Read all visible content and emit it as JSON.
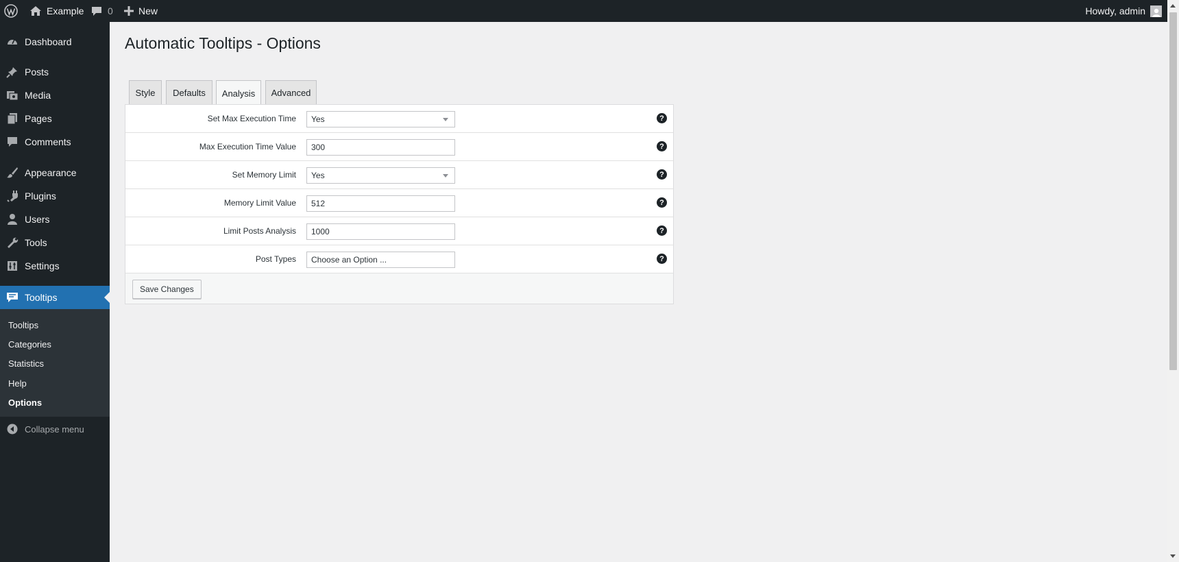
{
  "adminbar": {
    "site_name": "Example",
    "comments_count": "0",
    "new_label": "New",
    "greeting": "Howdy, admin"
  },
  "sidebar": {
    "items": [
      {
        "label": "Dashboard",
        "icon": "dashboard-icon"
      },
      {
        "label": "Posts",
        "icon": "pushpin-icon"
      },
      {
        "label": "Media",
        "icon": "media-icon"
      },
      {
        "label": "Pages",
        "icon": "pages-icon"
      },
      {
        "label": "Comments",
        "icon": "comment-icon"
      },
      {
        "label": "Appearance",
        "icon": "paintbrush-icon"
      },
      {
        "label": "Plugins",
        "icon": "plugin-icon"
      },
      {
        "label": "Users",
        "icon": "users-icon"
      },
      {
        "label": "Tools",
        "icon": "wrench-icon"
      },
      {
        "label": "Settings",
        "icon": "settings-icon"
      },
      {
        "label": "Tooltips",
        "icon": "tooltip-icon",
        "current": true
      }
    ],
    "submenu": [
      "Tooltips",
      "Categories",
      "Statistics",
      "Help",
      "Options"
    ],
    "submenu_current": "Options",
    "collapse_label": "Collapse menu"
  },
  "page": {
    "title": "Automatic Tooltips - Options",
    "tabs": [
      "Style",
      "Defaults",
      "Analysis",
      "Advanced"
    ],
    "active_tab": "Analysis",
    "rows": [
      {
        "label": "Set Max Execution Time",
        "value": "Yes",
        "type": "select"
      },
      {
        "label": "Max Execution Time Value",
        "value": "300",
        "type": "input"
      },
      {
        "label": "Set Memory Limit",
        "value": "Yes",
        "type": "select"
      },
      {
        "label": "Memory Limit Value",
        "value": "512",
        "type": "input"
      },
      {
        "label": "Limit Posts Analysis",
        "value": "1000",
        "type": "input"
      },
      {
        "label": "Post Types",
        "value": "Choose an Option ...",
        "type": "multiselect"
      }
    ],
    "help_glyph": "?",
    "save_label": "Save Changes"
  },
  "colors": {
    "admin_bar_bg": "#1d2327",
    "sidebar_bg": "#1d2327",
    "submenu_bg": "#2c3338",
    "accent": "#2271b1",
    "page_bg": "#f0f0f1"
  }
}
